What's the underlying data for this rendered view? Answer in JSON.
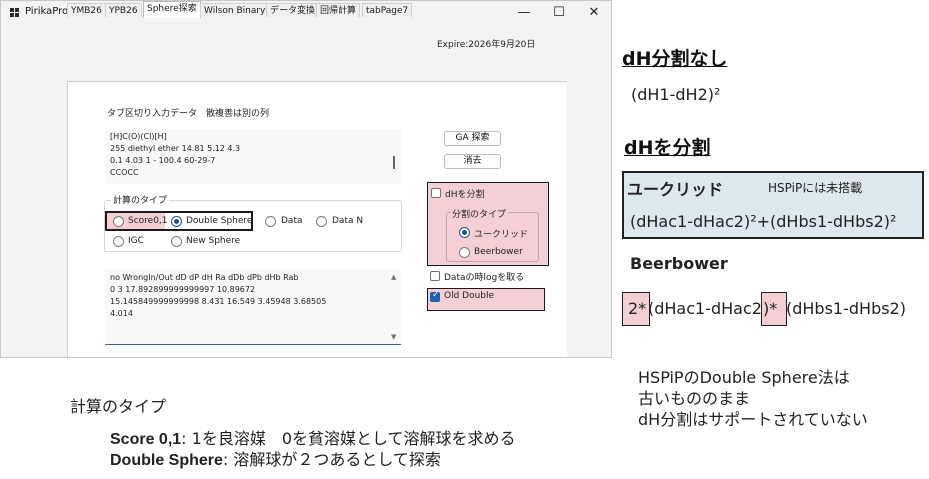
{
  "window": {
    "title": "PirikaProD",
    "minimize": "—",
    "maximize": "☐",
    "close": "✕",
    "expire": "Expire:2026年9月20日"
  },
  "tabs": [
    "YMB26",
    "YPB26",
    "Sphere探索",
    "Wilson Binary",
    "データ変換",
    "回帰計算",
    "tabPage7"
  ],
  "hint": "タブ区切り入力データ　散複善は別の列",
  "input_text": [
    "[H]C(O)(Cl)[H]",
    "255        diethyl ether           14.81      5.12        4.3",
    "0.1        4.03        1            -            100.4      60-29-7",
    "CCOCC"
  ],
  "buttons": {
    "ga": "GA 探索",
    "clear": "消去"
  },
  "calc_type": {
    "title": "計算のタイプ",
    "options": [
      "Score0,1",
      "Double Sphere",
      "Data",
      "Data N",
      "IGC",
      "New Sphere"
    ],
    "selected": "Double Sphere"
  },
  "split": {
    "check_label": "dHを分割",
    "group_title": "分割のタイプ",
    "options": [
      "ユークリッド",
      "Beerbower"
    ],
    "selected": "ユークリッド"
  },
  "log_check": "Dataの時logを取る",
  "old_double": "Old Double",
  "output_text": [
    "no   WrongIn/Out   dD  dP  dH  Ra  dDb dPb dHb Rab",
    "0          3              17.892899999999997  10.89672",
    "15.145849999999998  8.431        16.549        3.45948       3.68505",
    "4.014"
  ],
  "right": {
    "h1": "dH分割なし",
    "eq1": "(dH1-dH2)²",
    "h2": "dHを分割",
    "euclid_label": "ユークリッド",
    "hspip_note": "HSPiPには未搭載",
    "eq2": "(dHac1-dHac2)²+(dHbs1-dHbs2)²",
    "beerbower_label": "Beerbower",
    "eq3_a": "2*",
    "eq3_b": "(dHac1-dHac2",
    "eq3_c": ")*",
    "eq3_d": "(dHbs1-dHbs2)",
    "note": [
      "HSPiPのDouble Sphere法は",
      "古いもののまま",
      "dH分割はサポートされていない"
    ]
  },
  "bottom": {
    "title": "計算のタイプ",
    "line1_bold": "Score 0,1",
    "line1_rest": ": 1を良溶媒　0を貧溶媒として溶解球を求める",
    "line2_bold": "Double Sphere",
    "line2_rest": ": 溶解球が２つあるとして探索"
  },
  "colors": {
    "highlight_pink": "#f4cfd3",
    "note_blue": "#dde8ef",
    "radio_blue": "#1f4f9a"
  }
}
